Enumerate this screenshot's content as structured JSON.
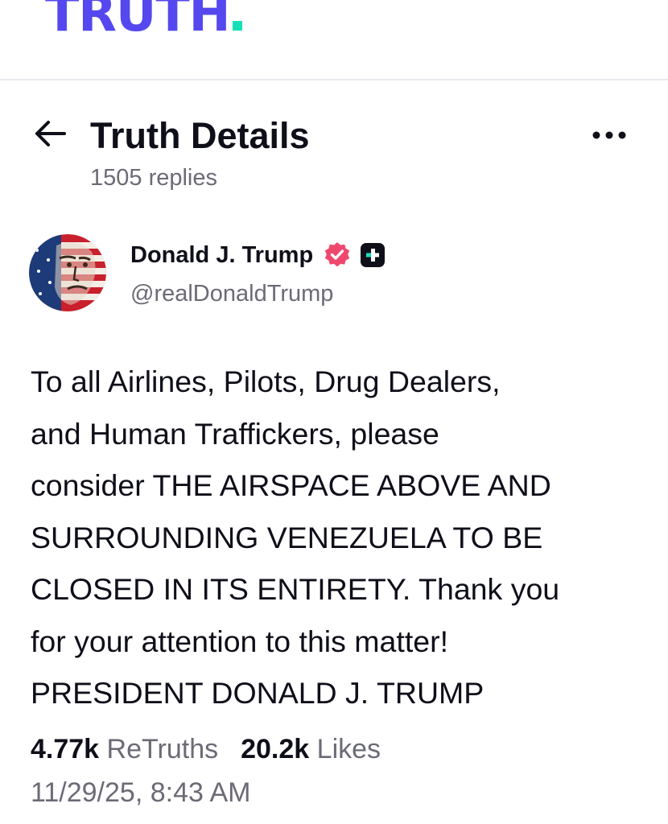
{
  "app": {
    "logo_text": "TRUTH",
    "brand_color": "#5448ee",
    "accent_color": "#17e0b8"
  },
  "header": {
    "title": "Truth Details",
    "reply_count": "1505 replies",
    "back_icon": "arrow-left-icon",
    "more_icon": "more-horizontal-icon"
  },
  "author": {
    "display_name": "Donald J. Trump",
    "handle": "@realDonaldTrump",
    "verified_icon": "verified-badge-icon",
    "verified_color": "#f0476e",
    "plus_badge_icon": "plus-badge-icon"
  },
  "post": {
    "text": "To all Airlines, Pilots, Drug Dealers,\nand Human Traffickers, please\nconsider THE AIRSPACE ABOVE AND\nSURROUNDING VENEZUELA TO BE\nCLOSED IN ITS ENTIRETY. Thank you\nfor your attention to this matter!\nPRESIDENT DONALD J. TRUMP",
    "retruths_count": "4.77k",
    "retruths_label": "ReTruths",
    "likes_count": "20.2k",
    "likes_label": "Likes",
    "timestamp": "11/29/25, 8:43 AM"
  }
}
